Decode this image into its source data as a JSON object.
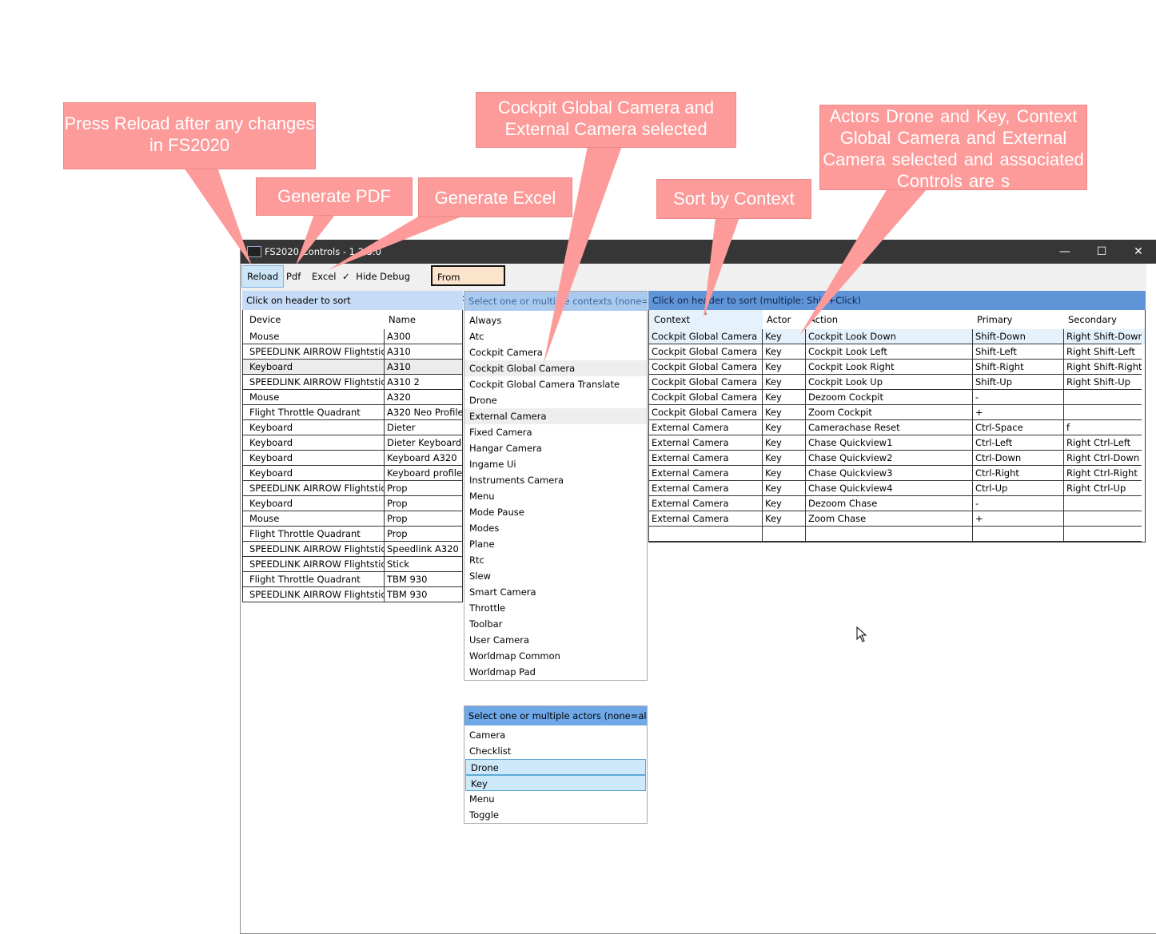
{
  "window": {
    "title": "FS2020 Controls - 1.2.5.0",
    "minimize": "—",
    "maximize": "☐",
    "close": "✕"
  },
  "toolbar": {
    "reload": "Reload",
    "pdf": "Pdf",
    "excel": "Excel",
    "hide_debug_check": "✓",
    "hide_debug": "Hide Debug",
    "from_database": "From Database"
  },
  "devices": {
    "header": "Click on header to sort",
    "columns": [
      "Device",
      "Name"
    ],
    "rows": [
      [
        "Mouse",
        "A300"
      ],
      [
        "SPEEDLINK AIRROW Flightstick",
        "A310"
      ],
      [
        "Keyboard",
        "A310"
      ],
      [
        "SPEEDLINK AIRROW Flightstick",
        "A310 2"
      ],
      [
        "Mouse",
        "A320"
      ],
      [
        "Flight Throttle Quadrant",
        "A320 Neo Profile"
      ],
      [
        "Keyboard",
        "Dieter"
      ],
      [
        "Keyboard",
        "Dieter Keyboard"
      ],
      [
        "Keyboard",
        "Keyboard A320"
      ],
      [
        "Keyboard",
        "Keyboard profile"
      ],
      [
        "SPEEDLINK AIRROW Flightstick",
        "Prop"
      ],
      [
        "Keyboard",
        "Prop"
      ],
      [
        "Mouse",
        "Prop"
      ],
      [
        "Flight Throttle Quadrant",
        "Prop"
      ],
      [
        "SPEEDLINK AIRROW Flightstick",
        "Speedlink A320"
      ],
      [
        "SPEEDLINK AIRROW Flightstick",
        "Stick"
      ],
      [
        "Flight Throttle Quadrant",
        "TBM 930"
      ],
      [
        "SPEEDLINK AIRROW Flightstick",
        "TBM 930"
      ]
    ],
    "selected_index": 2
  },
  "contexts": {
    "header": "Select one or multiple contexts (none=all)",
    "items": [
      "Always",
      "Atc",
      "Cockpit Camera",
      "Cockpit Global Camera",
      "Cockpit Global Camera Translate",
      "Drone",
      "External Camera",
      "Fixed Camera",
      "Hangar Camera",
      "Ingame Ui",
      "Instruments Camera",
      "Menu",
      "Mode Pause",
      "Modes",
      "Plane",
      "Rtc",
      "Slew",
      "Smart Camera",
      "Throttle",
      "Toolbar",
      "User Camera",
      "Worldmap Common",
      "Worldmap Pad"
    ],
    "selected": [
      "Cockpit Global Camera",
      "External Camera"
    ]
  },
  "actors": {
    "header": "Select one or multiple actors (none=all)",
    "items": [
      "Camera",
      "Checklist",
      "Drone",
      "Key",
      "Menu",
      "Toggle"
    ],
    "selected": [
      "Drone",
      "Key"
    ]
  },
  "controls": {
    "header": "Click on header to sort (multiple: Shift+Click)",
    "sort_glyph": "▴",
    "columns": [
      "Context",
      "Actor",
      "Action",
      "Primary",
      "Secondary"
    ],
    "rows": [
      [
        "Cockpit Global Camera",
        "Key",
        "Cockpit Look Down",
        "Shift-Down",
        "Right Shift-Down"
      ],
      [
        "Cockpit Global Camera",
        "Key",
        "Cockpit Look Left",
        "Shift-Left",
        "Right Shift-Left"
      ],
      [
        "Cockpit Global Camera",
        "Key",
        "Cockpit Look Right",
        "Shift-Right",
        "Right Shift-Right"
      ],
      [
        "Cockpit Global Camera",
        "Key",
        "Cockpit Look Up",
        "Shift-Up",
        "Right Shift-Up"
      ],
      [
        "Cockpit Global Camera",
        "Key",
        "Dezoom Cockpit",
        "-",
        ""
      ],
      [
        "Cockpit Global Camera",
        "Key",
        "Zoom Cockpit",
        "+",
        ""
      ],
      [
        "External Camera",
        "Key",
        "Camerachase Reset",
        "Ctrl-Space",
        "f"
      ],
      [
        "External Camera",
        "Key",
        "Chase Quickview1",
        "Ctrl-Left",
        "Right Ctrl-Left"
      ],
      [
        "External Camera",
        "Key",
        "Chase Quickview2",
        "Ctrl-Down",
        "Right Ctrl-Down"
      ],
      [
        "External Camera",
        "Key",
        "Chase Quickview3",
        "Ctrl-Right",
        "Right Ctrl-Right"
      ],
      [
        "External Camera",
        "Key",
        "Chase Quickview4",
        "Ctrl-Up",
        "Right Ctrl-Up"
      ],
      [
        "External Camera",
        "Key",
        "Dezoom Chase",
        "-",
        ""
      ],
      [
        "External Camera",
        "Key",
        "Zoom Chase",
        "+",
        ""
      ],
      [
        "",
        "",
        "",
        "",
        ""
      ]
    ]
  },
  "callouts": {
    "reload": "Press Reload after any changes in FS2020",
    "pdf": "Generate PDF",
    "excel": "Generate Excel",
    "contexts": "Cockpit Global Camera and External Camera selected",
    "sort": "Sort by Context",
    "actors": "Actors Drone and Key, Context Global Camera and External Camera selected and associated Controls are s"
  },
  "colors": {
    "callout": "#fd9a9a",
    "titlebar": "#363636",
    "selection": "#cde8f8"
  }
}
